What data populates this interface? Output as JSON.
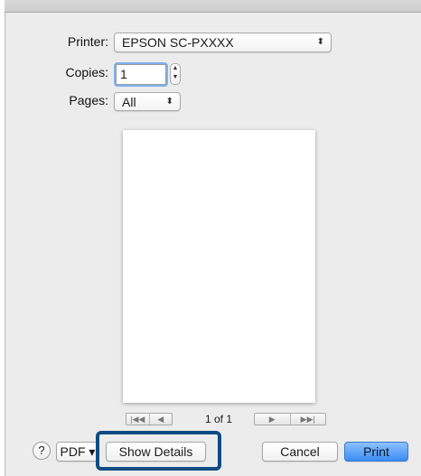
{
  "printer": {
    "label": "Printer:",
    "value": "EPSON SC-PXXXX",
    "arrows": "⬍"
  },
  "copies": {
    "label": "Copies:",
    "value": "1"
  },
  "pages": {
    "label": "Pages:",
    "value": "All",
    "arrows": "⬍"
  },
  "preview": {
    "first_prev": [
      "|◀◀",
      "◀"
    ],
    "next_last": [
      "▶",
      "▶▶|"
    ],
    "page_count": "1 of 1"
  },
  "bottom": {
    "help_label": "?",
    "pdf_label": "PDF ▾",
    "show_details_label": "Show Details",
    "cancel_label": "Cancel",
    "print_label": "Print"
  },
  "colors": {
    "highlight": "#0f4c83",
    "default_button": "#3b8cf5"
  }
}
